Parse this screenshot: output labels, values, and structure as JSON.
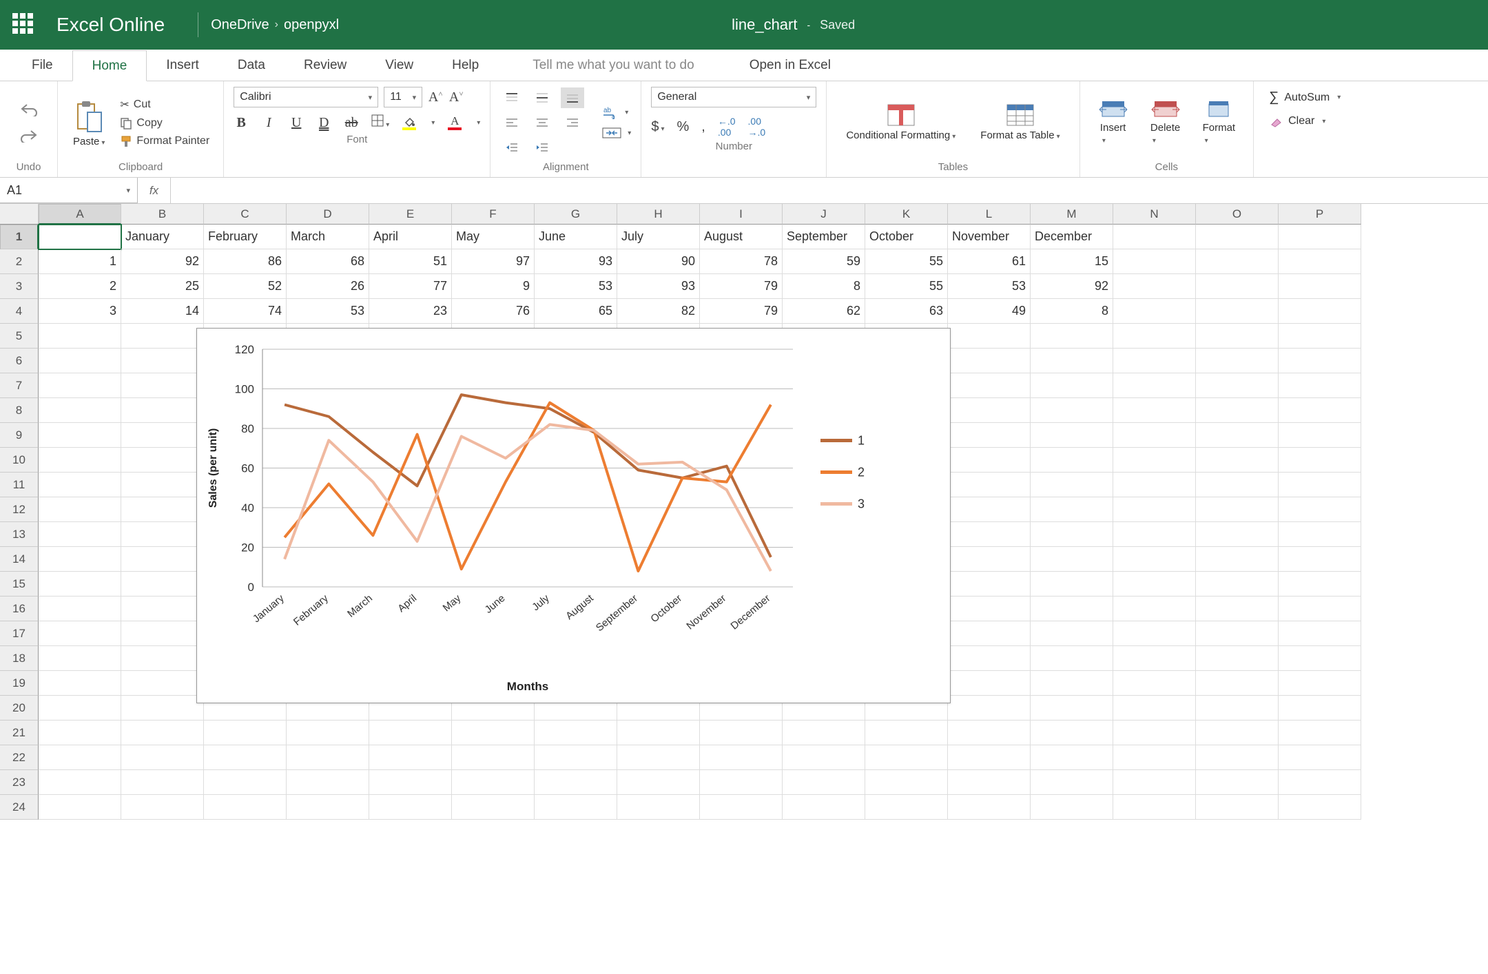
{
  "titlebar": {
    "app_name": "Excel Online",
    "breadcrumb_root": "OneDrive",
    "breadcrumb_leaf": "openpyxl",
    "doc_title": "line_chart",
    "doc_sep": "-",
    "doc_status": "Saved"
  },
  "tabs": {
    "file": "File",
    "home": "Home",
    "insert": "Insert",
    "data": "Data",
    "review": "Review",
    "view": "View",
    "help": "Help",
    "tellme": "Tell me what you want to do",
    "open_in_excel": "Open in Excel"
  },
  "ribbon": {
    "undo_group": "Undo",
    "clipboard": {
      "paste": "Paste",
      "cut": "Cut",
      "copy": "Copy",
      "format_painter": "Format Painter",
      "group": "Clipboard"
    },
    "font": {
      "name": "Calibri",
      "size": "11",
      "group": "Font"
    },
    "alignment": {
      "group": "Alignment"
    },
    "number": {
      "format": "General",
      "group": "Number"
    },
    "tables": {
      "conditional_formatting": "Conditional Formatting",
      "format_as_table": "Format as Table",
      "group": "Tables"
    },
    "cells": {
      "insert": "Insert",
      "delete": "Delete",
      "format": "Format",
      "group": "Cells"
    },
    "editing": {
      "autosum": "AutoSum",
      "clear": "Clear"
    }
  },
  "formula_bar": {
    "name_box": "A1"
  },
  "grid": {
    "columns": [
      "A",
      "B",
      "C",
      "D",
      "E",
      "F",
      "G",
      "H",
      "I",
      "J",
      "K",
      "L",
      "M",
      "N",
      "O",
      "P"
    ],
    "row_count": 24,
    "headers_row": [
      "",
      "January",
      "February",
      "March",
      "April",
      "May",
      "June",
      "July",
      "August",
      "September",
      "October",
      "November",
      "December"
    ],
    "data_rows": [
      [
        "1",
        92,
        86,
        68,
        51,
        97,
        93,
        90,
        78,
        59,
        55,
        61,
        15
      ],
      [
        "2",
        25,
        52,
        26,
        77,
        9,
        53,
        93,
        79,
        8,
        55,
        53,
        92
      ],
      [
        "3",
        14,
        74,
        53,
        23,
        76,
        65,
        82,
        79,
        62,
        63,
        49,
        8
      ]
    ]
  },
  "chart_data": {
    "type": "line",
    "categories": [
      "January",
      "February",
      "March",
      "April",
      "May",
      "June",
      "July",
      "August",
      "September",
      "October",
      "November",
      "December"
    ],
    "series": [
      {
        "name": "1",
        "values": [
          92,
          86,
          68,
          51,
          97,
          93,
          90,
          78,
          59,
          55,
          61,
          15
        ],
        "color": "#b96a3a"
      },
      {
        "name": "2",
        "values": [
          25,
          52,
          26,
          77,
          9,
          53,
          93,
          79,
          8,
          55,
          53,
          92
        ],
        "color": "#ed7d31"
      },
      {
        "name": "3",
        "values": [
          14,
          74,
          53,
          23,
          76,
          65,
          82,
          79,
          62,
          63,
          49,
          8
        ],
        "color": "#f0b9a0"
      }
    ],
    "xlabel": "Months",
    "ylabel": "Sales (per unit)",
    "ylim": [
      0,
      120
    ],
    "yticks": [
      0,
      20,
      40,
      60,
      80,
      100,
      120
    ],
    "title": ""
  }
}
